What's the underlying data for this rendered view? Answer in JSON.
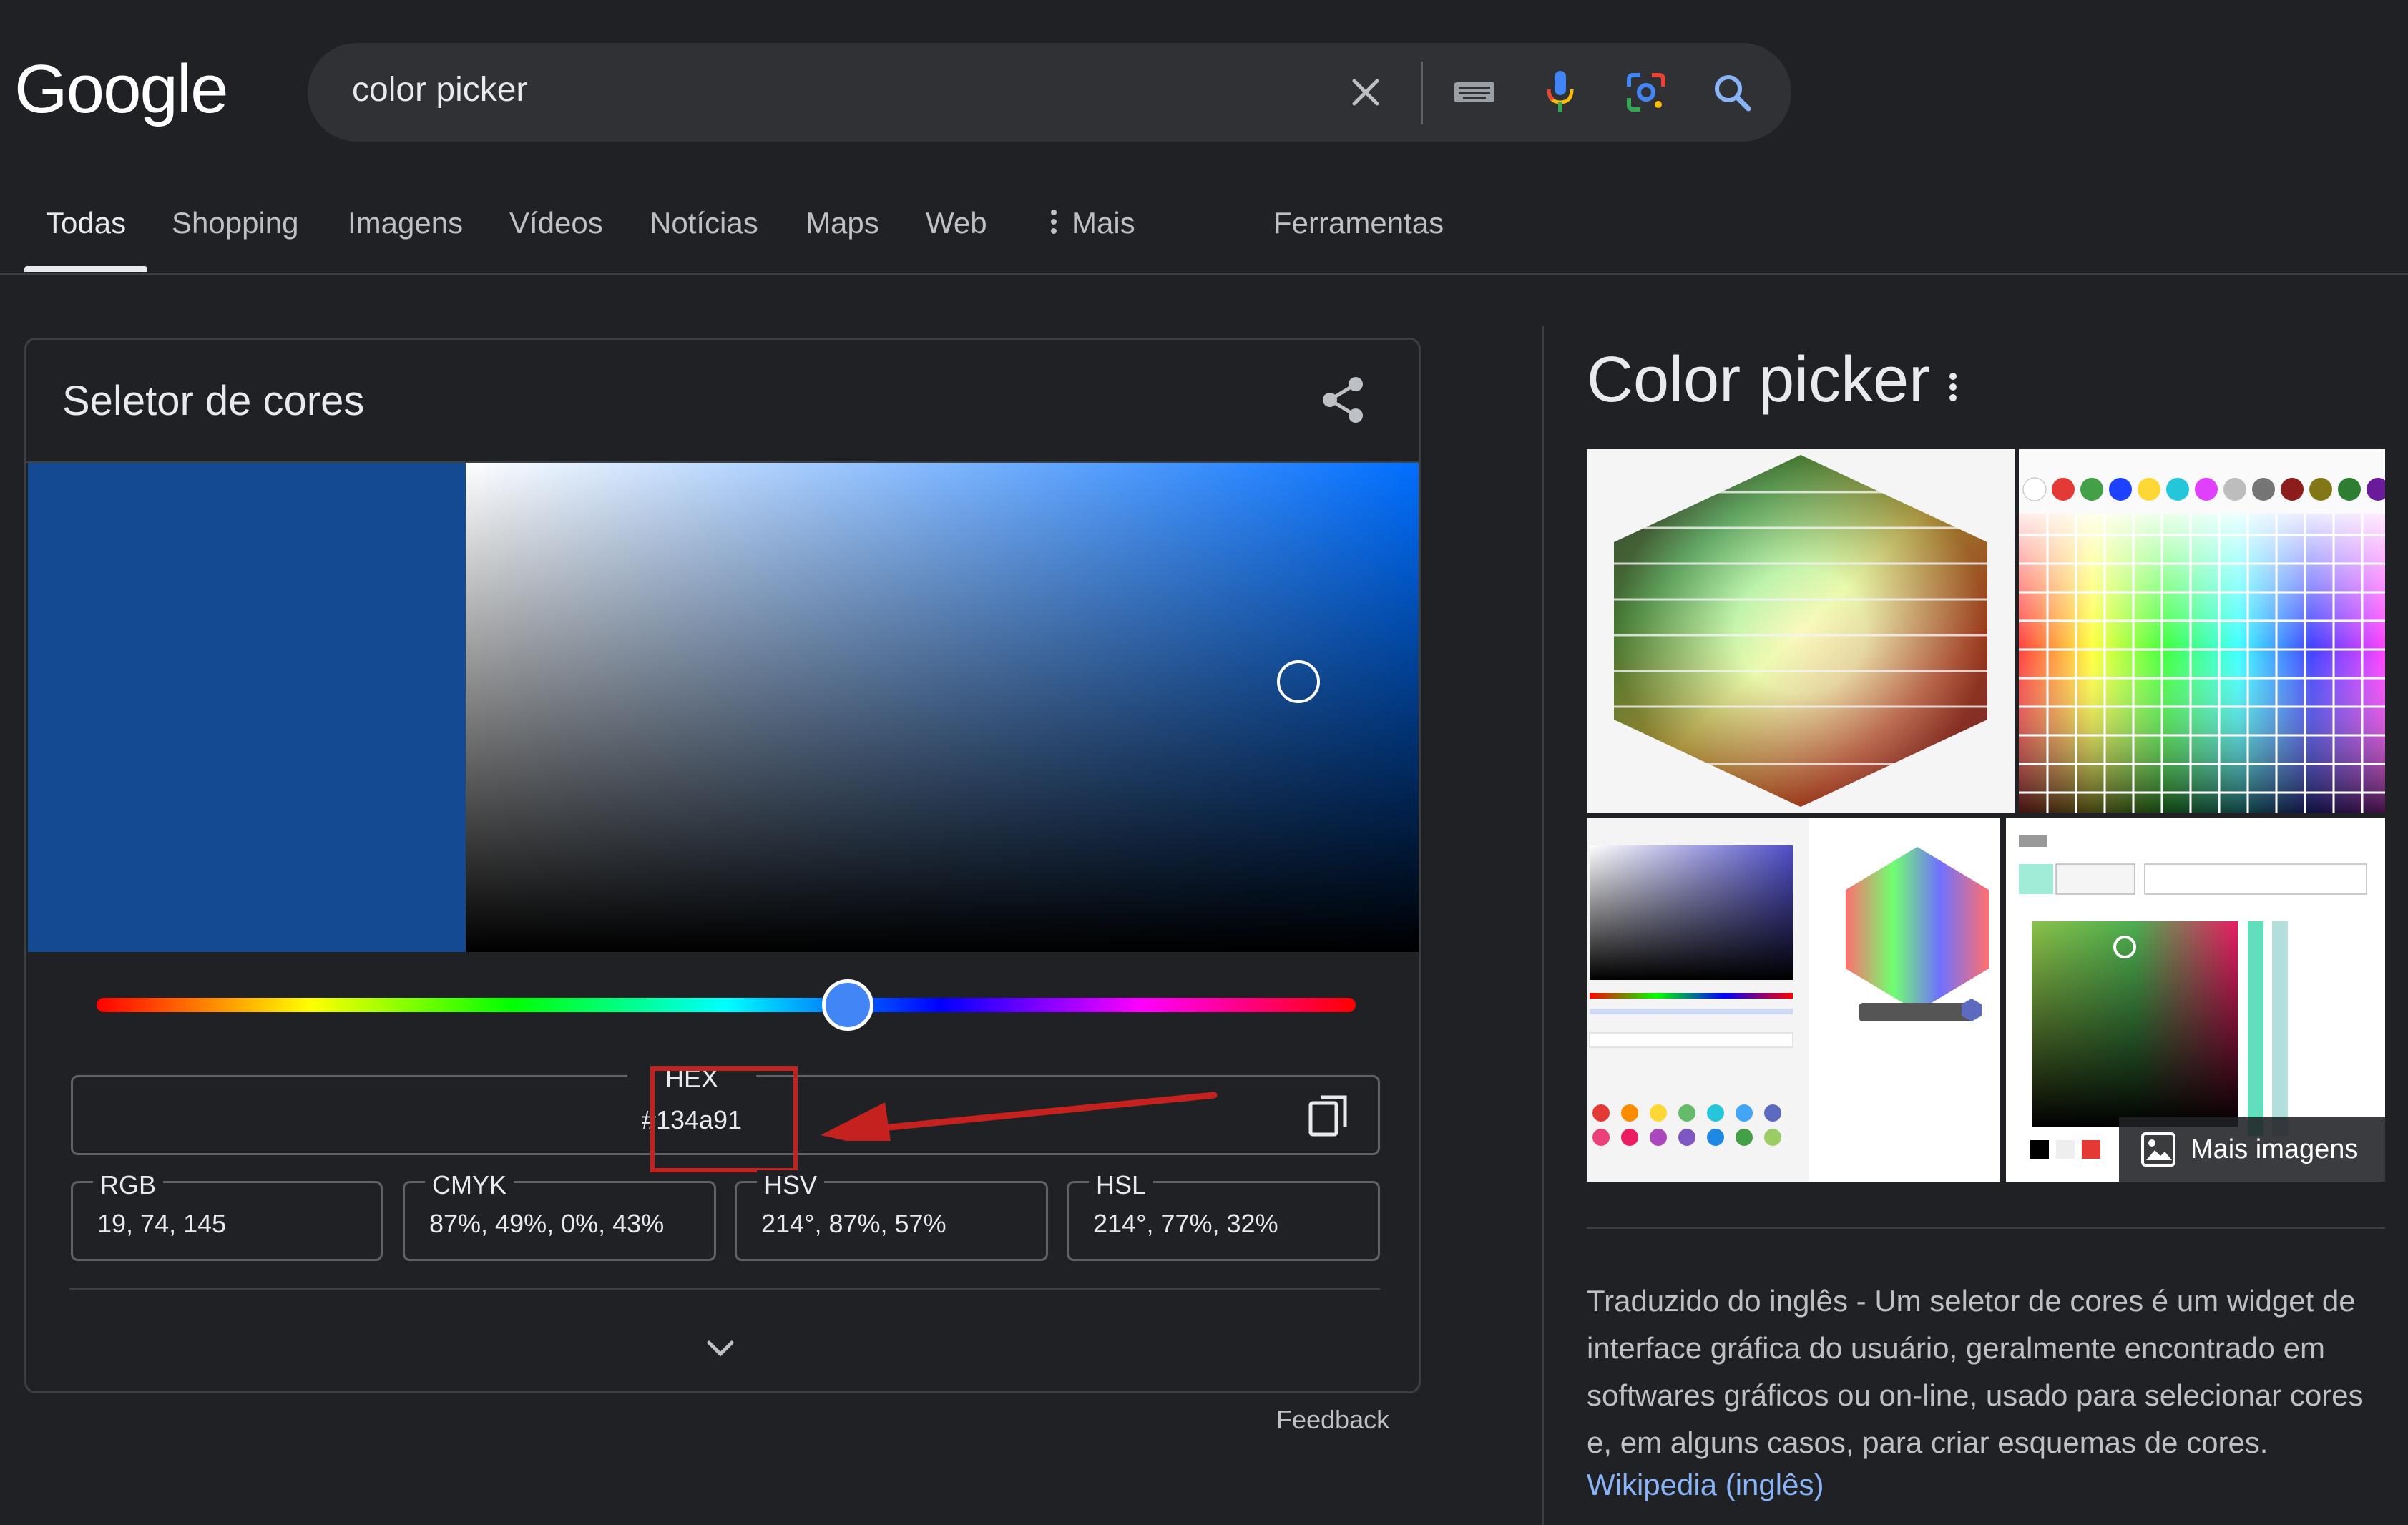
{
  "header": {
    "logo": "Google",
    "search": {
      "query": "color picker",
      "icons": [
        "clear-icon",
        "keyboard-icon",
        "mic-icon",
        "lens-icon",
        "search-icon"
      ]
    }
  },
  "tabs": [
    {
      "label": "Todas",
      "active": true
    },
    {
      "label": "Shopping"
    },
    {
      "label": "Imagens"
    },
    {
      "label": "Vídeos"
    },
    {
      "label": "Notícias"
    },
    {
      "label": "Maps"
    },
    {
      "label": "Web"
    },
    {
      "label": "Mais"
    },
    {
      "label": "Ferramentas"
    }
  ],
  "picker": {
    "title": "Seletor de cores",
    "hue_deg": 214,
    "hex_label": "HEX",
    "hex_value": "#134a91",
    "values": [
      {
        "label": "RGB",
        "value": "19, 74, 145"
      },
      {
        "label": "CMYK",
        "value": "87%, 49%, 0%, 43%"
      },
      {
        "label": "HSV",
        "value": "214°, 87%, 57%"
      },
      {
        "label": "HSL",
        "value": "214°, 77%, 32%"
      }
    ],
    "colors": {
      "selected": "#134a91",
      "annotation": "#c5221f"
    }
  },
  "feedback": "Feedback",
  "knowledge_panel": {
    "title": "Color picker",
    "more_images": "Mais imagens",
    "description": "Traduzido do inglês - Um seletor de cores é um widget de interface gráfica do usuário, geralmente encontrado em softwares gráficos ou on-line, usado para selecionar cores e, em alguns casos, para criar esquemas de cores.",
    "source": "Wikipedia (inglês)"
  }
}
